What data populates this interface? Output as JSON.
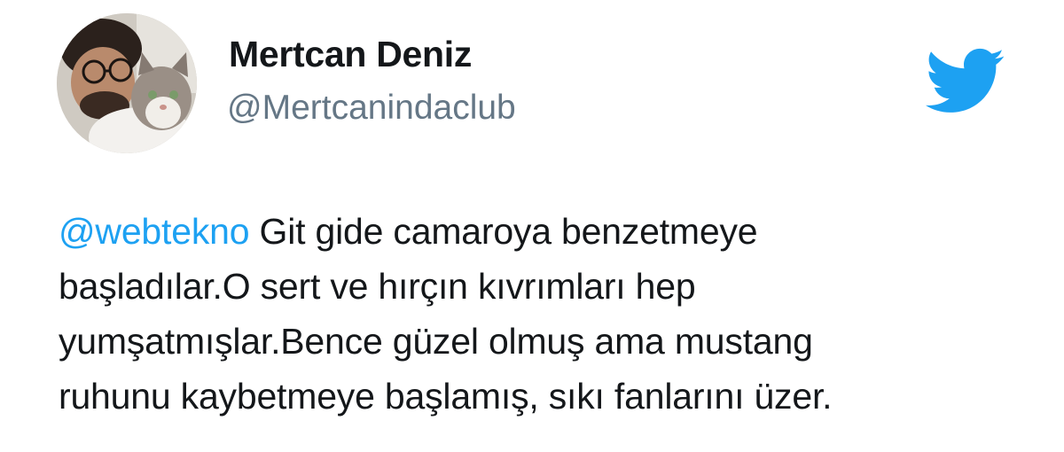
{
  "author": {
    "name": "Mertcan Deniz",
    "handle": "@Mertcanindaclub"
  },
  "tweet": {
    "mention": "@webtekno",
    "lines": [
      " Git gide camaroya benzetmeye",
      "başladılar.O sert ve hırçın kıvrımları hep",
      "yumşatmışlar.Bence güzel olmuş ama mustang",
      "ruhunu kaybetmeye başlamış, sıkı fanlarını üzer."
    ]
  },
  "icons": {
    "brand": "twitter-bird-icon",
    "avatar": "profile-photo"
  },
  "colors": {
    "brand": "#1da1f2",
    "name": "#14171a",
    "handle": "#657786",
    "text": "#14171a"
  }
}
